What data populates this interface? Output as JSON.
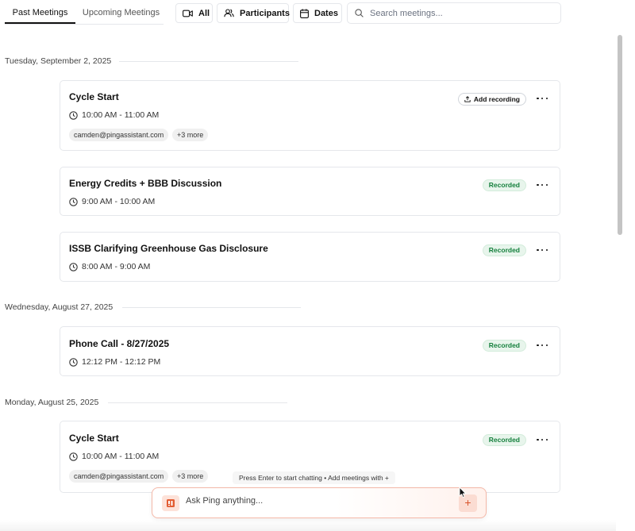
{
  "tabs": [
    {
      "label": "Past Meetings",
      "active": true
    },
    {
      "label": "Upcoming Meetings",
      "active": false
    }
  ],
  "filters": {
    "all_label": "All",
    "participants_label": "Participants",
    "dates_label": "Dates"
  },
  "search": {
    "placeholder": "Search meetings..."
  },
  "groups": [
    {
      "date": "Tuesday, September 2, 2025",
      "meetings": [
        {
          "title": "Cycle Start",
          "time": "10:00 AM - 11:00 AM",
          "status": "Add recording",
          "participant": "camden@pingassistant.com",
          "more": "+3 more"
        },
        {
          "title": "Energy Credits + BBB Discussion",
          "time": "9:00 AM - 10:00 AM",
          "status": "Recorded"
        },
        {
          "title": "ISSB Clarifying Greenhouse Gas Disclosure",
          "time": "8:00 AM - 9:00 AM",
          "status": "Recorded"
        }
      ]
    },
    {
      "date": "Wednesday, August 27, 2025",
      "meetings": [
        {
          "title": "Phone Call - 8/27/2025",
          "time": "12:12 PM - 12:12 PM",
          "status": "Recorded"
        }
      ]
    },
    {
      "date": "Monday, August 25, 2025",
      "meetings": [
        {
          "title": "Cycle Start",
          "time": "10:00 AM - 11:00 AM",
          "status": "Recorded",
          "participant": "camden@pingassistant.com",
          "more": "+3 more"
        }
      ]
    }
  ],
  "chat": {
    "hint": "Press Enter to start chatting • Add meetings with +",
    "placeholder": "Ask Ping anything...",
    "add_label": "+"
  },
  "colors": {
    "recorded_bg": "#e8f5ec",
    "recorded_text": "#15803d",
    "chat_accent": "#d9532b"
  },
  "icons": [
    "video-icon",
    "participants-icon",
    "calendar-icon",
    "search-icon",
    "clock-icon",
    "upload-icon",
    "more-icon",
    "ping-logo-icon",
    "cursor-icon"
  ]
}
